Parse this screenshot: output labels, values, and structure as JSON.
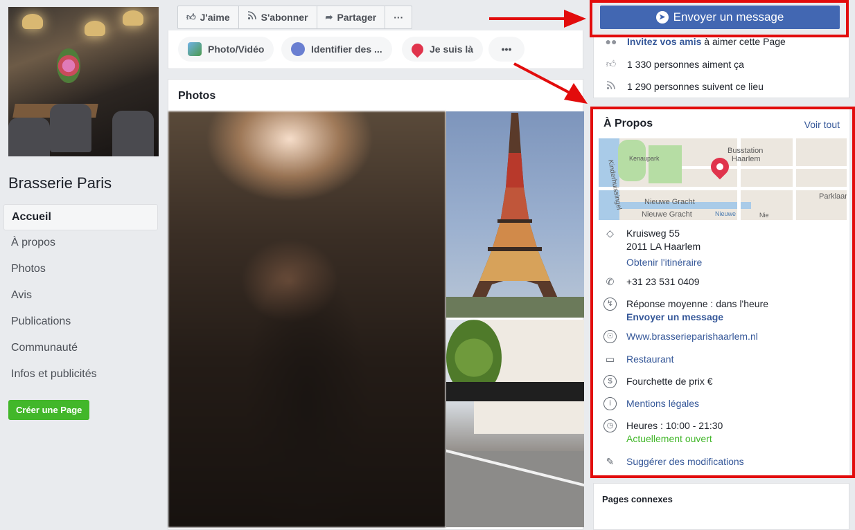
{
  "page": {
    "name": "Brasserie Paris"
  },
  "nav": [
    {
      "label": "Accueil",
      "active": true
    },
    {
      "label": "À propos"
    },
    {
      "label": "Photos"
    },
    {
      "label": "Avis"
    },
    {
      "label": "Publications"
    },
    {
      "label": "Communauté"
    },
    {
      "label": "Infos et publicités"
    }
  ],
  "create_page": "Créer une Page",
  "actions": [
    {
      "label": "J'aime",
      "icon": "thumb-up-icon"
    },
    {
      "label": "S'abonner",
      "icon": "rss-icon"
    },
    {
      "label": "Partager",
      "icon": "share-arrow-icon"
    },
    {
      "label": "···",
      "icon": "more-icon"
    }
  ],
  "composer": [
    {
      "label": "Photo/Vidéo",
      "icon": "photo-icon"
    },
    {
      "label": "Identifier des ...",
      "icon": "tag-people-icon"
    },
    {
      "label": "Je suis là",
      "icon": "location-pin-icon"
    },
    {
      "label": "•••",
      "icon": "more-icon"
    }
  ],
  "photos": {
    "title": "Photos"
  },
  "message_button": "Envoyer un message",
  "stats": {
    "invite_strong": "Invitez vos amis",
    "invite_rest": " à aimer cette Page",
    "likes": "1 330 personnes aiment ça",
    "follows": "1 290 personnes suivent ce lieu"
  },
  "about": {
    "title": "À Propos",
    "see_all": "Voir tout",
    "map_labels": {
      "park": "Kenaupark",
      "station_1": "Busstation",
      "station_2": "Haarlem",
      "canal": "Nieuwe Gracht",
      "canal_2": "Nieuwe Gracht",
      "canal_3": "Nieuwe",
      "street": "Kinderhuissingel",
      "parklaan": "Parklaan",
      "ni": "Nie"
    },
    "address_line1": "Kruisweg 55",
    "address_line2": "2011 LA Haarlem",
    "directions": "Obtenir l'itinéraire",
    "phone": "+31 23 531 0409",
    "response": "Réponse moyenne : dans l'heure",
    "send_message": "Envoyer un message",
    "website": "Www.brasserieparishaarlem.nl",
    "category": "Restaurant",
    "price": "Fourchette de prix €",
    "legal": "Mentions légales",
    "hours": "Heures : 10:00 - 21:30",
    "open_now": "Actuellement ouvert",
    "suggest": "Suggérer des modifications"
  },
  "related": {
    "title": "Pages connexes"
  },
  "colors": {
    "facebook_blue": "#4267b2",
    "link": "#365899",
    "highlight_red": "#e20c0c",
    "green": "#42b72a"
  }
}
